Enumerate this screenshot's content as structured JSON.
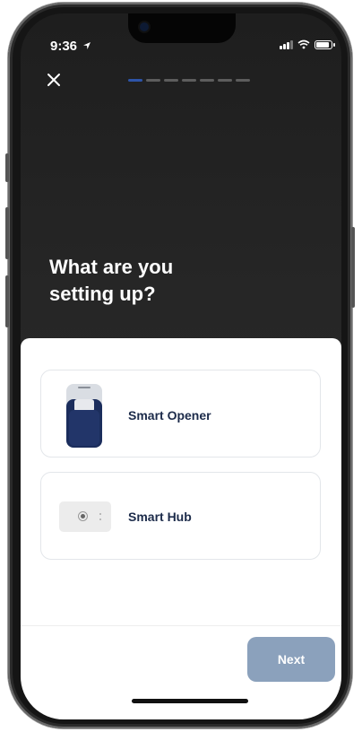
{
  "status_bar": {
    "time": "9:36",
    "location_icon": "location-arrow-icon",
    "signal_icon": "signal-icon",
    "wifi_icon": "wifi-icon",
    "battery_icon": "battery-icon"
  },
  "header": {
    "close_icon": "close-icon",
    "progress": {
      "total_steps": 7,
      "current_step": 1
    }
  },
  "title": {
    "line1": "What are you",
    "line2": "setting up?"
  },
  "options": [
    {
      "label": "Smart Opener",
      "icon": "smart-opener-device-icon"
    },
    {
      "label": "Smart Hub",
      "icon": "smart-hub-device-icon"
    }
  ],
  "footer": {
    "next_label": "Next"
  },
  "colors": {
    "header_background": "#262626",
    "accent": "#2d54a8",
    "next_button_disabled": "#8ba1bc",
    "option_text": "#1c2b4a"
  }
}
